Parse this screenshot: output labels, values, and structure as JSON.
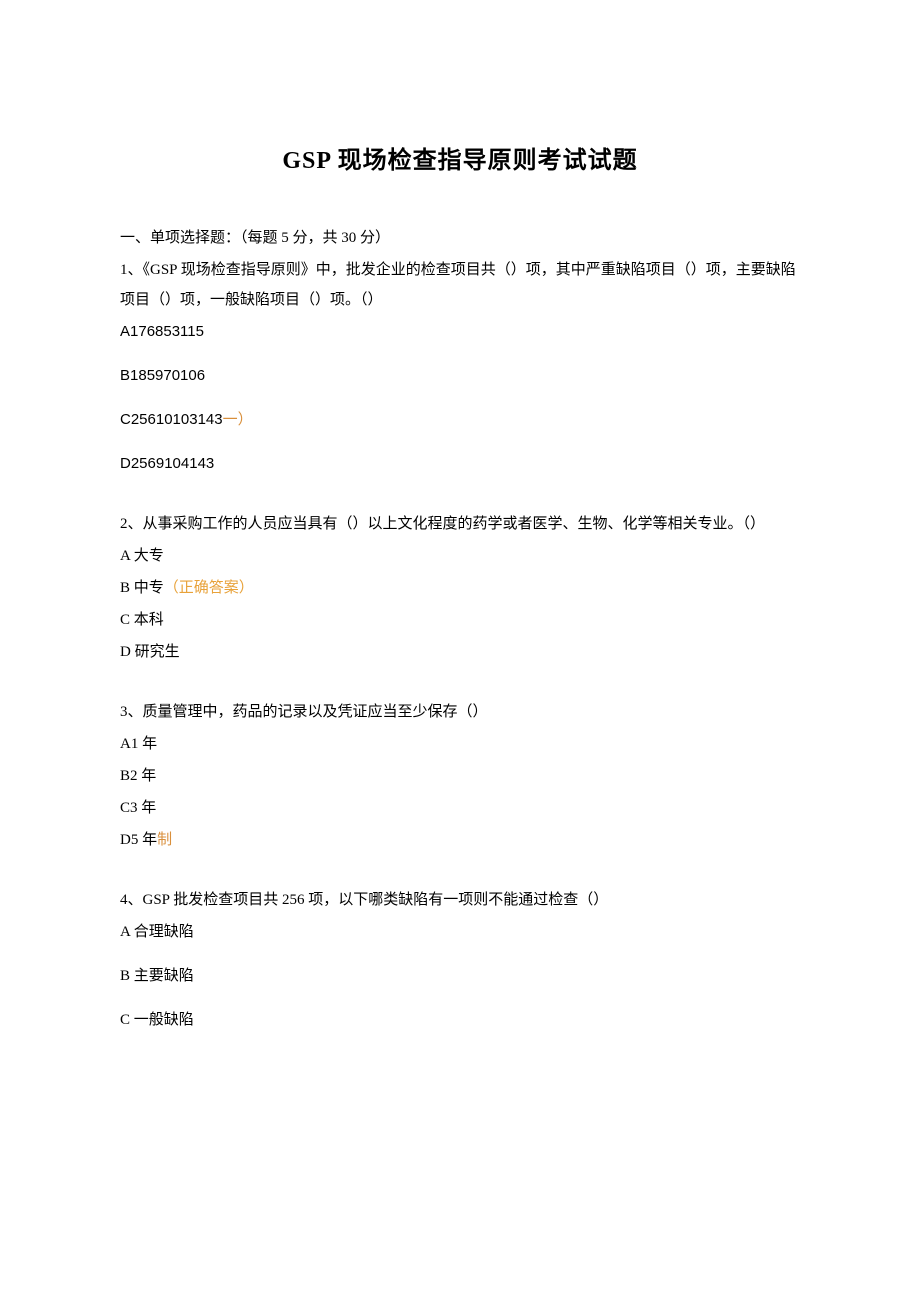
{
  "title": "GSP 现场检查指导原则考试试题",
  "section1": {
    "header": "一、单项选择题：（每题 5 分，共 30 分）"
  },
  "q1": {
    "text": "1、《GSP 现场检查指导原则》中，批发企业的检查项目共（）项，其中严重缺陷项目（）项，主要缺陷项目（）项，一般缺陷项目（）项。（）",
    "optA": "A176853115",
    "optB": "B185970106",
    "optC_prefix": "C25610103143",
    "optC_suffix": "一）",
    "optD": "D2569104143"
  },
  "q2": {
    "text": "2、从事采购工作的人员应当具有（）以上文化程度的药学或者医学、生物、化学等相关专业。（）",
    "optA": "A 大专",
    "optB_prefix": "B 中专",
    "optB_correct": "（正确答案）",
    "optC": "C 本科",
    "optD": "D 研究生"
  },
  "q3": {
    "text": "3、质量管理中，药品的记录以及凭证应当至少保存（）",
    "optA": "A1 年",
    "optB": "B2 年",
    "optC": "C3 年",
    "optD_prefix": "D5 年",
    "optD_suffix": "制"
  },
  "q4": {
    "text": "4、GSP 批发检查项目共 256 项，以下哪类缺陷有一项则不能通过检查（）",
    "optA": "A 合理缺陷",
    "optB": "B 主要缺陷",
    "optC": "C 一般缺陷"
  }
}
